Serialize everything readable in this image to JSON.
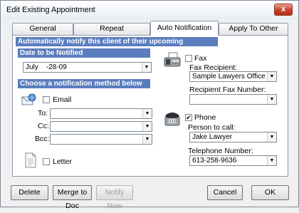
{
  "window": {
    "title": "Edit Existing Appointment",
    "close_label": "x"
  },
  "tabs": [
    {
      "label": "General"
    },
    {
      "label": "Repeat"
    },
    {
      "label": "Auto Notification"
    },
    {
      "label": "Apply To Other Users"
    }
  ],
  "auto": {
    "header": "Automatically notify this client of their upcoming appointment",
    "date_section": "Date to be Notified",
    "date_value": "July    -28-09",
    "method_section": "Choose a notification method below",
    "email_label": "Email",
    "to_label": "To:",
    "cc_label": "Cc:",
    "bcc_label": "Bcc:",
    "letter_label": "Letter",
    "fax_label": "Fax",
    "fax_recipient_label": "Fax Recipient:",
    "fax_recipient_value": "Sample Lawyers Office c/o Ja",
    "recipient_fax_number_label": "Recipient Fax Number:",
    "recipient_fax_number_value": "",
    "phone_label": "Phone",
    "phone_checked_mark": "✔",
    "person_to_call_label": "Person to call:",
    "person_to_call_value": "Jake Lawyer",
    "telephone_number_label": "Telephone Number:",
    "telephone_number_value": "613-258-9636"
  },
  "buttons": {
    "delete": "Delete",
    "merge": "Merge to Doc",
    "notify": "Notify Now",
    "cancel": "Cancel",
    "ok": "OK"
  },
  "colors": {
    "section_bar": "#5a7dbd",
    "close_button": "#c8402a"
  }
}
